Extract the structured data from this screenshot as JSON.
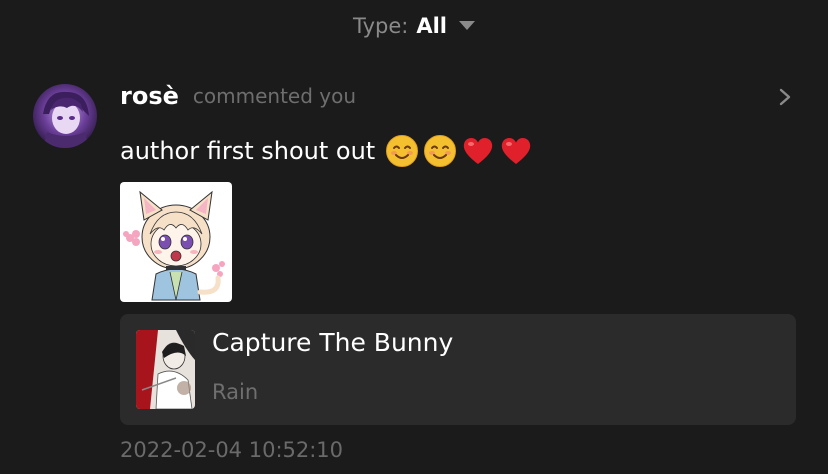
{
  "filter": {
    "label": "Type:",
    "value": "All",
    "caret_icon": "triangle-down-icon"
  },
  "notification": {
    "username": "rosè",
    "action": "commented you",
    "comment_text": "author first shout out",
    "emojis": [
      "smiling-face-emoji",
      "smiling-face-emoji",
      "red-heart-emoji",
      "red-heart-emoji"
    ],
    "sticker": "anime-cat-girl-sticker",
    "book": {
      "title": "Capture The Bunny",
      "author": "Rain"
    },
    "timestamp": "2022-02-04 10:52:10"
  },
  "colors": {
    "background": "#1b1b1b",
    "card": "#2b2b2b",
    "muted_text": "#6e6e6e",
    "primary_text": "#ffffff"
  }
}
